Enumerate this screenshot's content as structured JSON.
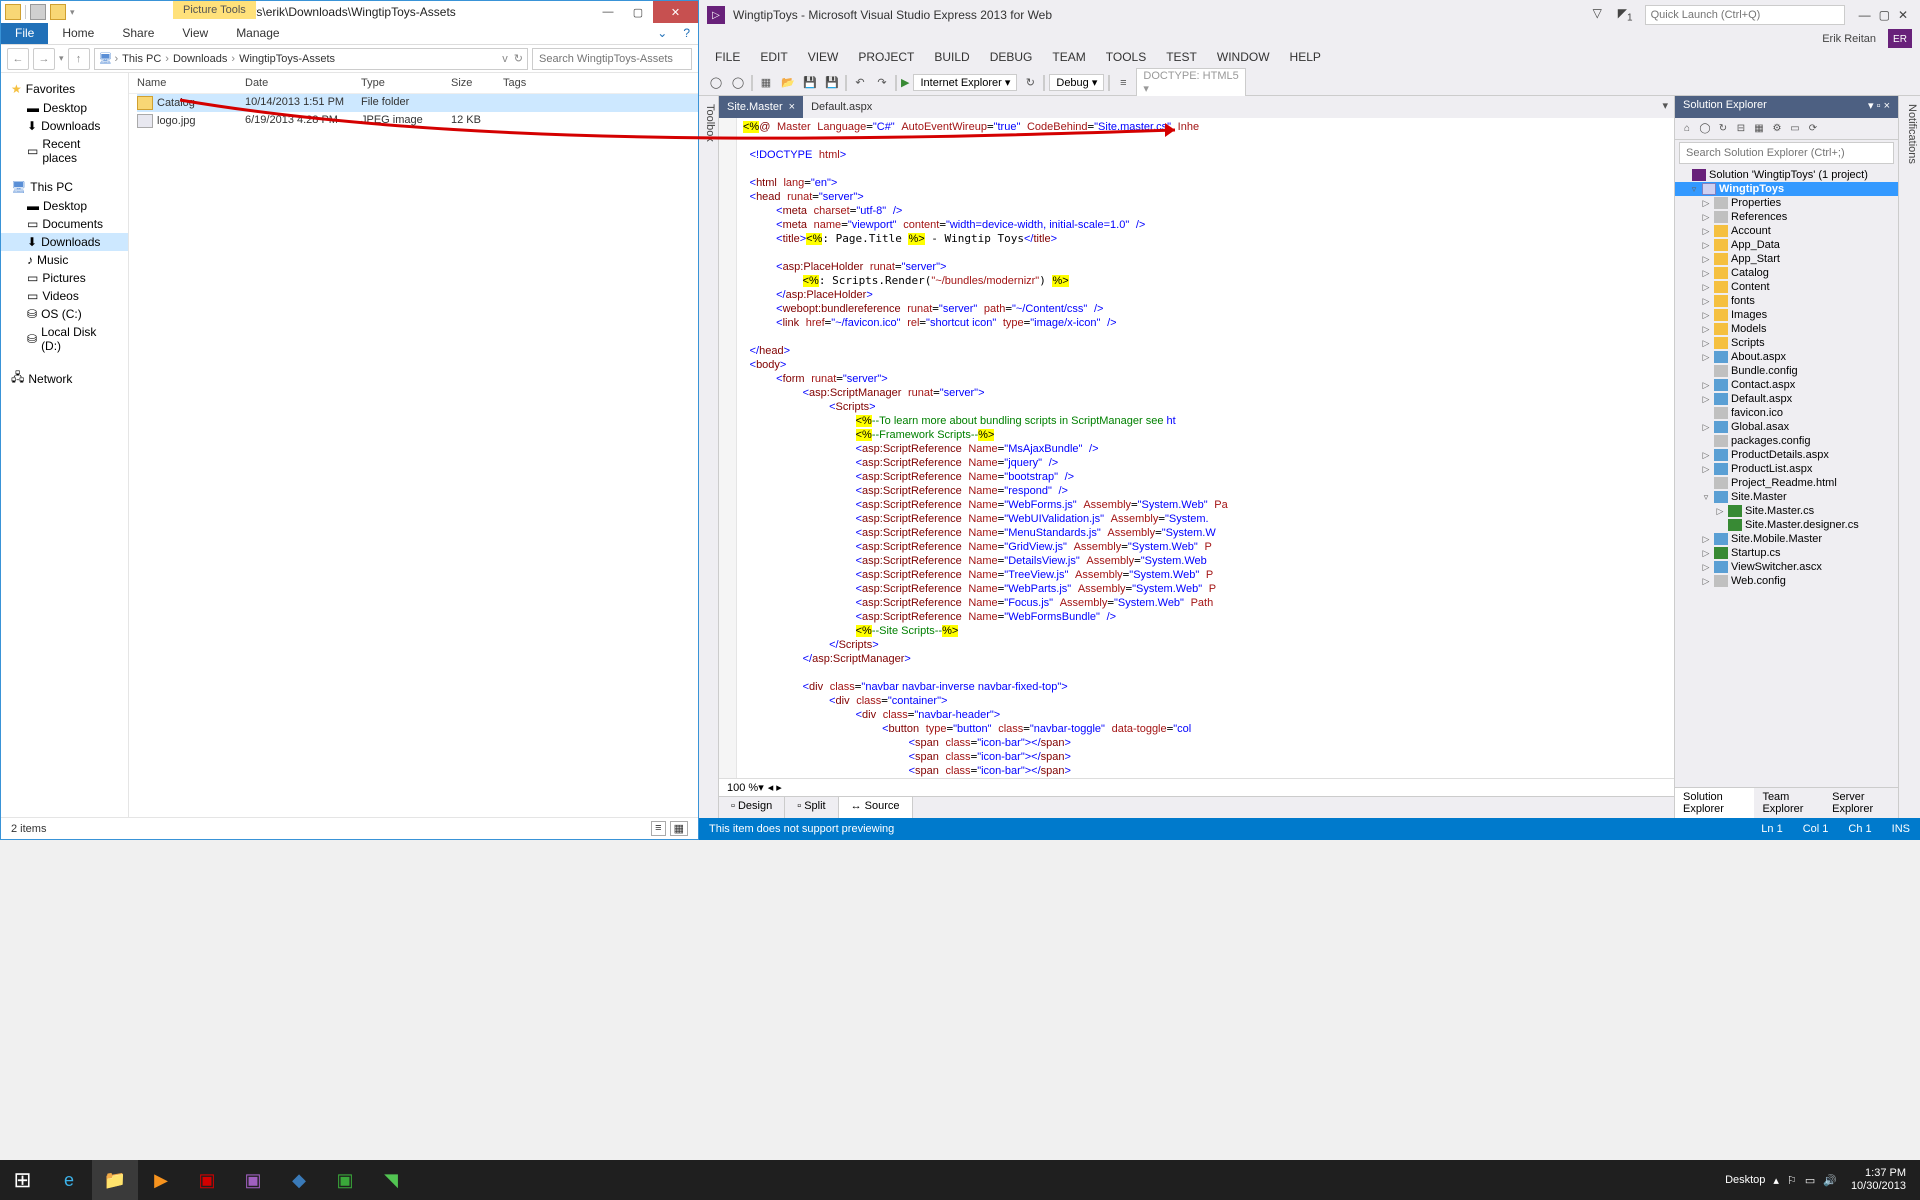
{
  "explorer": {
    "title": "C:\\Users\\erik\\Downloads\\WingtipToys-Assets",
    "context_tab": "Picture Tools",
    "ribbon": {
      "file": "File",
      "tabs": [
        "Home",
        "Share",
        "View",
        "Manage"
      ]
    },
    "breadcrumbs": [
      "This PC",
      "Downloads",
      "WingtipToys-Assets"
    ],
    "search_placeholder": "Search WingtipToys-Assets",
    "columns": {
      "name": "Name",
      "date": "Date",
      "type": "Type",
      "size": "Size",
      "tags": "Tags"
    },
    "rows": [
      {
        "name": "Catalog",
        "date": "10/14/2013 1:51 PM",
        "type": "File folder",
        "size": "",
        "kind": "folder",
        "selected": true
      },
      {
        "name": "logo.jpg",
        "date": "6/19/2013 4:28 PM",
        "type": "JPEG image",
        "size": "12 KB",
        "kind": "image",
        "selected": false
      }
    ],
    "favorites": {
      "header": "Favorites",
      "items": [
        "Desktop",
        "Downloads",
        "Recent places"
      ]
    },
    "thispc": {
      "header": "This PC",
      "items": [
        "Desktop",
        "Documents",
        "Downloads",
        "Music",
        "Pictures",
        "Videos",
        "OS (C:)",
        "Local Disk (D:)"
      ],
      "selected": "Downloads"
    },
    "network": {
      "header": "Network"
    },
    "status": "2 items"
  },
  "vs": {
    "title": "WingtipToys - Microsoft Visual Studio Express 2013 for Web",
    "user": "Erik Reitan",
    "badge": "ER",
    "quicklaunch_placeholder": "Quick Launch (Ctrl+Q)",
    "menu": [
      "FILE",
      "EDIT",
      "VIEW",
      "PROJECT",
      "BUILD",
      "DEBUG",
      "TEAM",
      "TOOLS",
      "TEST",
      "WINDOW",
      "HELP"
    ],
    "toolbar": {
      "browser": "Internet Explorer",
      "config": "Debug",
      "doctype": "DOCTYPE: HTML5"
    },
    "tabs": [
      {
        "label": "Site.Master",
        "active": true
      },
      {
        "label": "Default.aspx",
        "active": false
      }
    ],
    "zoom": "100 %",
    "viewtabs": {
      "design": "Design",
      "split": "Split",
      "source": "Source",
      "active": "Source"
    },
    "solution": {
      "header": "Solution Explorer",
      "search_placeholder": "Search Solution Explorer (Ctrl+;)",
      "root": "Solution 'WingtipToys' (1 project)",
      "project": "WingtipToys",
      "nodes": [
        {
          "label": "Properties",
          "icon": "cfg",
          "exp": "▷"
        },
        {
          "label": "References",
          "icon": "cfg",
          "exp": "▷"
        },
        {
          "label": "Account",
          "icon": "fold",
          "exp": "▷"
        },
        {
          "label": "App_Data",
          "icon": "fold",
          "exp": "▷"
        },
        {
          "label": "App_Start",
          "icon": "fold",
          "exp": "▷"
        },
        {
          "label": "Catalog",
          "icon": "fold",
          "exp": "▷"
        },
        {
          "label": "Content",
          "icon": "fold",
          "exp": "▷"
        },
        {
          "label": "fonts",
          "icon": "fold",
          "exp": "▷"
        },
        {
          "label": "Images",
          "icon": "fold",
          "exp": "▷"
        },
        {
          "label": "Models",
          "icon": "fold",
          "exp": "▷"
        },
        {
          "label": "Scripts",
          "icon": "fold",
          "exp": "▷"
        },
        {
          "label": "About.aspx",
          "icon": "asp",
          "exp": "▷"
        },
        {
          "label": "Bundle.config",
          "icon": "cfg",
          "exp": ""
        },
        {
          "label": "Contact.aspx",
          "icon": "asp",
          "exp": "▷"
        },
        {
          "label": "Default.aspx",
          "icon": "asp",
          "exp": "▷"
        },
        {
          "label": "favicon.ico",
          "icon": "cfg",
          "exp": ""
        },
        {
          "label": "Global.asax",
          "icon": "asp",
          "exp": "▷"
        },
        {
          "label": "packages.config",
          "icon": "cfg",
          "exp": ""
        },
        {
          "label": "ProductDetails.aspx",
          "icon": "asp",
          "exp": "▷"
        },
        {
          "label": "ProductList.aspx",
          "icon": "asp",
          "exp": "▷"
        },
        {
          "label": "Project_Readme.html",
          "icon": "cfg",
          "exp": ""
        },
        {
          "label": "Site.Master",
          "icon": "asp",
          "exp": "▿",
          "open": true
        },
        {
          "label": "Site.Master.cs",
          "icon": "cs",
          "exp": "▷",
          "indent": 1
        },
        {
          "label": "Site.Master.designer.cs",
          "icon": "cs",
          "exp": "",
          "indent": 1
        },
        {
          "label": "Site.Mobile.Master",
          "icon": "asp",
          "exp": "▷"
        },
        {
          "label": "Startup.cs",
          "icon": "cs",
          "exp": "▷"
        },
        {
          "label": "ViewSwitcher.ascx",
          "icon": "asp",
          "exp": "▷"
        },
        {
          "label": "Web.config",
          "icon": "cfg",
          "exp": "▷"
        }
      ],
      "bottom_tabs": [
        "Solution Explorer",
        "Team Explorer",
        "Server Explorer"
      ]
    },
    "status": {
      "msg": "This item does not support previewing",
      "ln": "Ln 1",
      "col": "Col 1",
      "ch": "Ch 1",
      "ins": "INS"
    }
  },
  "taskbar": {
    "tray": {
      "desktop": "Desktop",
      "time": "1:37 PM",
      "date": "10/30/2013"
    }
  }
}
